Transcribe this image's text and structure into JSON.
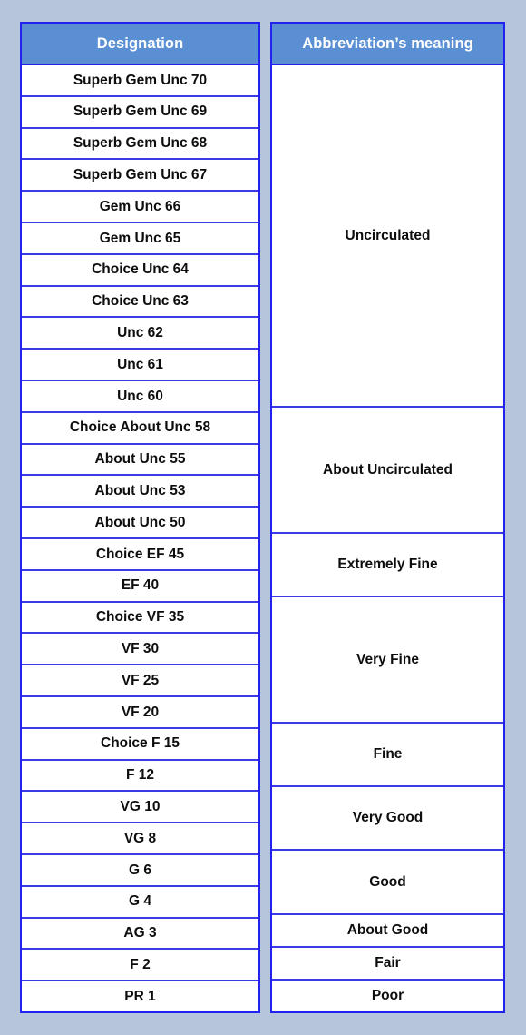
{
  "table": {
    "headers": {
      "designation": "Designation",
      "meaning": "Abbreviation’s meaning"
    },
    "colors": {
      "page_background": "#b6c5dc",
      "header_fill": "#5b8fd4",
      "header_text": "#ffffff",
      "border": "#2222ee",
      "inner_border": "#3a3ae8",
      "cell_background": "#ffffff",
      "cell_text": "#0d0d0d"
    },
    "designations": [
      "Superb Gem Unc 70",
      "Superb Gem Unc 69",
      "Superb Gem Unc 68",
      "Superb Gem Unc 67",
      "Gem Unc 66",
      "Gem Unc 65",
      "Choice Unc 64",
      "Choice Unc 63",
      "Unc 62",
      "Unc 61",
      "Unc 60",
      "Choice About Unc 58",
      "About Unc 55",
      "About Unc 53",
      "About Unc 50",
      "Choice EF 45",
      "EF 40",
      "Choice VF 35",
      "VF 30",
      "VF 25",
      "VF 20",
      "Choice F 15",
      "F 12",
      "VG 10",
      "VG 8",
      "G 6",
      "G 4",
      "AG 3",
      "F 2",
      "PR 1"
    ],
    "meanings": [
      {
        "label": "Uncirculated",
        "rows": 11
      },
      {
        "label": "About Uncirculated",
        "rows": 4
      },
      {
        "label": "Extremely Fine",
        "rows": 2
      },
      {
        "label": "Very Fine",
        "rows": 4
      },
      {
        "label": "Fine",
        "rows": 2
      },
      {
        "label": "Very Good",
        "rows": 2
      },
      {
        "label": "Good",
        "rows": 2
      },
      {
        "label": "About Good",
        "rows": 1
      },
      {
        "label": "Fair",
        "rows": 1
      },
      {
        "label": "Poor",
        "rows": 1
      }
    ]
  }
}
